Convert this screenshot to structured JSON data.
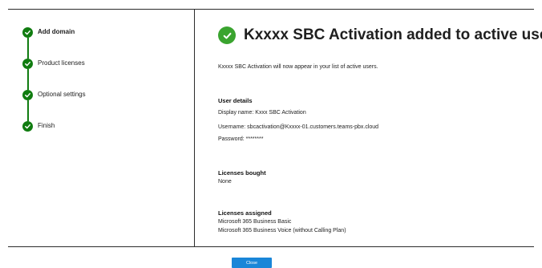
{
  "steps": [
    {
      "label": "Add domain"
    },
    {
      "label": "Product licenses"
    },
    {
      "label": "Optional settings"
    },
    {
      "label": "Finish"
    }
  ],
  "main": {
    "title": "Kxxxx SBC Activation added to active users",
    "intro": "Kxxxx SBC Activation will now appear in your list of active users.",
    "user_details": {
      "heading": "User details",
      "display_name": "Display name: Kxxx SBC Activation",
      "username": "Username: sbcactivation@Kxxxx-01.customers.teams-pbx.cloud",
      "password": "Password: ********"
    },
    "licenses_bought": {
      "heading": "Licenses bought",
      "value": "None"
    },
    "licenses_assigned": {
      "heading": "Licenses assigned",
      "items": [
        "Microsoft 365 Business Basic",
        "Microsoft 365 Business Voice (without Calling Plan)"
      ]
    }
  },
  "footer": {
    "close_label": "Close"
  },
  "colors": {
    "step_green": "#107c10",
    "success_green": "#3aa42f",
    "primary_blue": "#1a86d8"
  },
  "icons": {
    "step": "checkmark-icon",
    "title": "success-check-icon"
  }
}
